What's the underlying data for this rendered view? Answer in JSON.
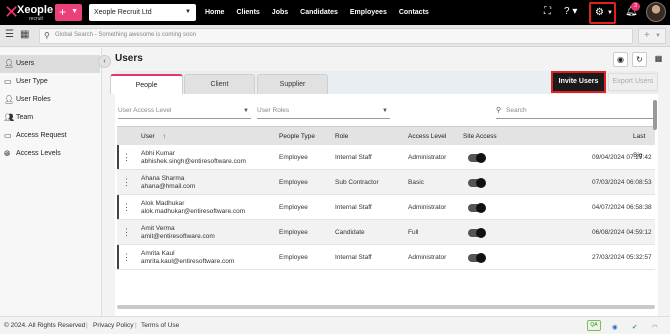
{
  "topbar": {
    "logo_brand": "Xeople",
    "logo_sub": "recruit",
    "company": "Xeople Recruit Ltd",
    "nav": [
      "Home",
      "Clients",
      "Jobs",
      "Candidates",
      "Employees",
      "Contacts"
    ],
    "notification_count": "3"
  },
  "search": {
    "placeholder": "Global Search - Something awesome is coming soon"
  },
  "sidebar": {
    "items": [
      {
        "label": "Users",
        "icon": "user-icon"
      },
      {
        "label": "User Type",
        "icon": "id-card-icon"
      },
      {
        "label": "User Roles",
        "icon": "user-roles-icon"
      },
      {
        "label": "Team",
        "icon": "team-icon"
      },
      {
        "label": "Access Request",
        "icon": "monitor-icon"
      },
      {
        "label": "Access Levels",
        "icon": "globe-icon"
      }
    ]
  },
  "main": {
    "title": "Users",
    "tabs": [
      "People",
      "Client",
      "Supplier"
    ],
    "invite_label": "Invite Users",
    "export_label": "Export Users",
    "filters": {
      "access_level_placeholder": "User Access Level",
      "roles_placeholder": "User Roles",
      "search_placeholder": "Search"
    }
  },
  "table": {
    "columns": [
      "User",
      "People Type",
      "Role",
      "Access Level",
      "Site Access",
      "Last Sig"
    ],
    "rows": [
      {
        "name": "Abhi Kumar",
        "email": "abhishek.singh@entiresoftware.com",
        "type": "Employee",
        "role": "Internal Staff",
        "access": "Administrator",
        "site_access": true,
        "last": "09/04/2024 07:27:42"
      },
      {
        "name": "Ahana Sharma",
        "email": "ahana@hmail.com",
        "type": "Employee",
        "role": "Sub Contractor",
        "access": "Basic",
        "site_access": true,
        "last": "07/03/2024 06:08:53"
      },
      {
        "name": "Alok Madhukar",
        "email": "alok.madhukar@entiresoftware.com",
        "type": "Employee",
        "role": "Internal Staff",
        "access": "Administrator",
        "site_access": true,
        "last": "04/07/2024 06:58:38"
      },
      {
        "name": "Amit Verma",
        "email": "amit@entiresoftware.com",
        "type": "Employee",
        "role": "Candidate",
        "access": "Full",
        "site_access": true,
        "last": "06/08/2024 04:59:12"
      },
      {
        "name": "Amrita Kaul",
        "email": "amrita.kaul@entiresoftware.com",
        "type": "Employee",
        "role": "Internal Staff",
        "access": "Administrator",
        "site_access": true,
        "last": "27/03/2024 05:32:57"
      }
    ]
  },
  "footer": {
    "copyright": "© 2024. All Rights Reserved",
    "privacy": "Privacy Policy",
    "terms": "Terms of Use",
    "env_badge": "QA"
  },
  "colors": {
    "accent": "#e8336d",
    "highlight_border": "#e32020",
    "topbar": "#000000"
  }
}
